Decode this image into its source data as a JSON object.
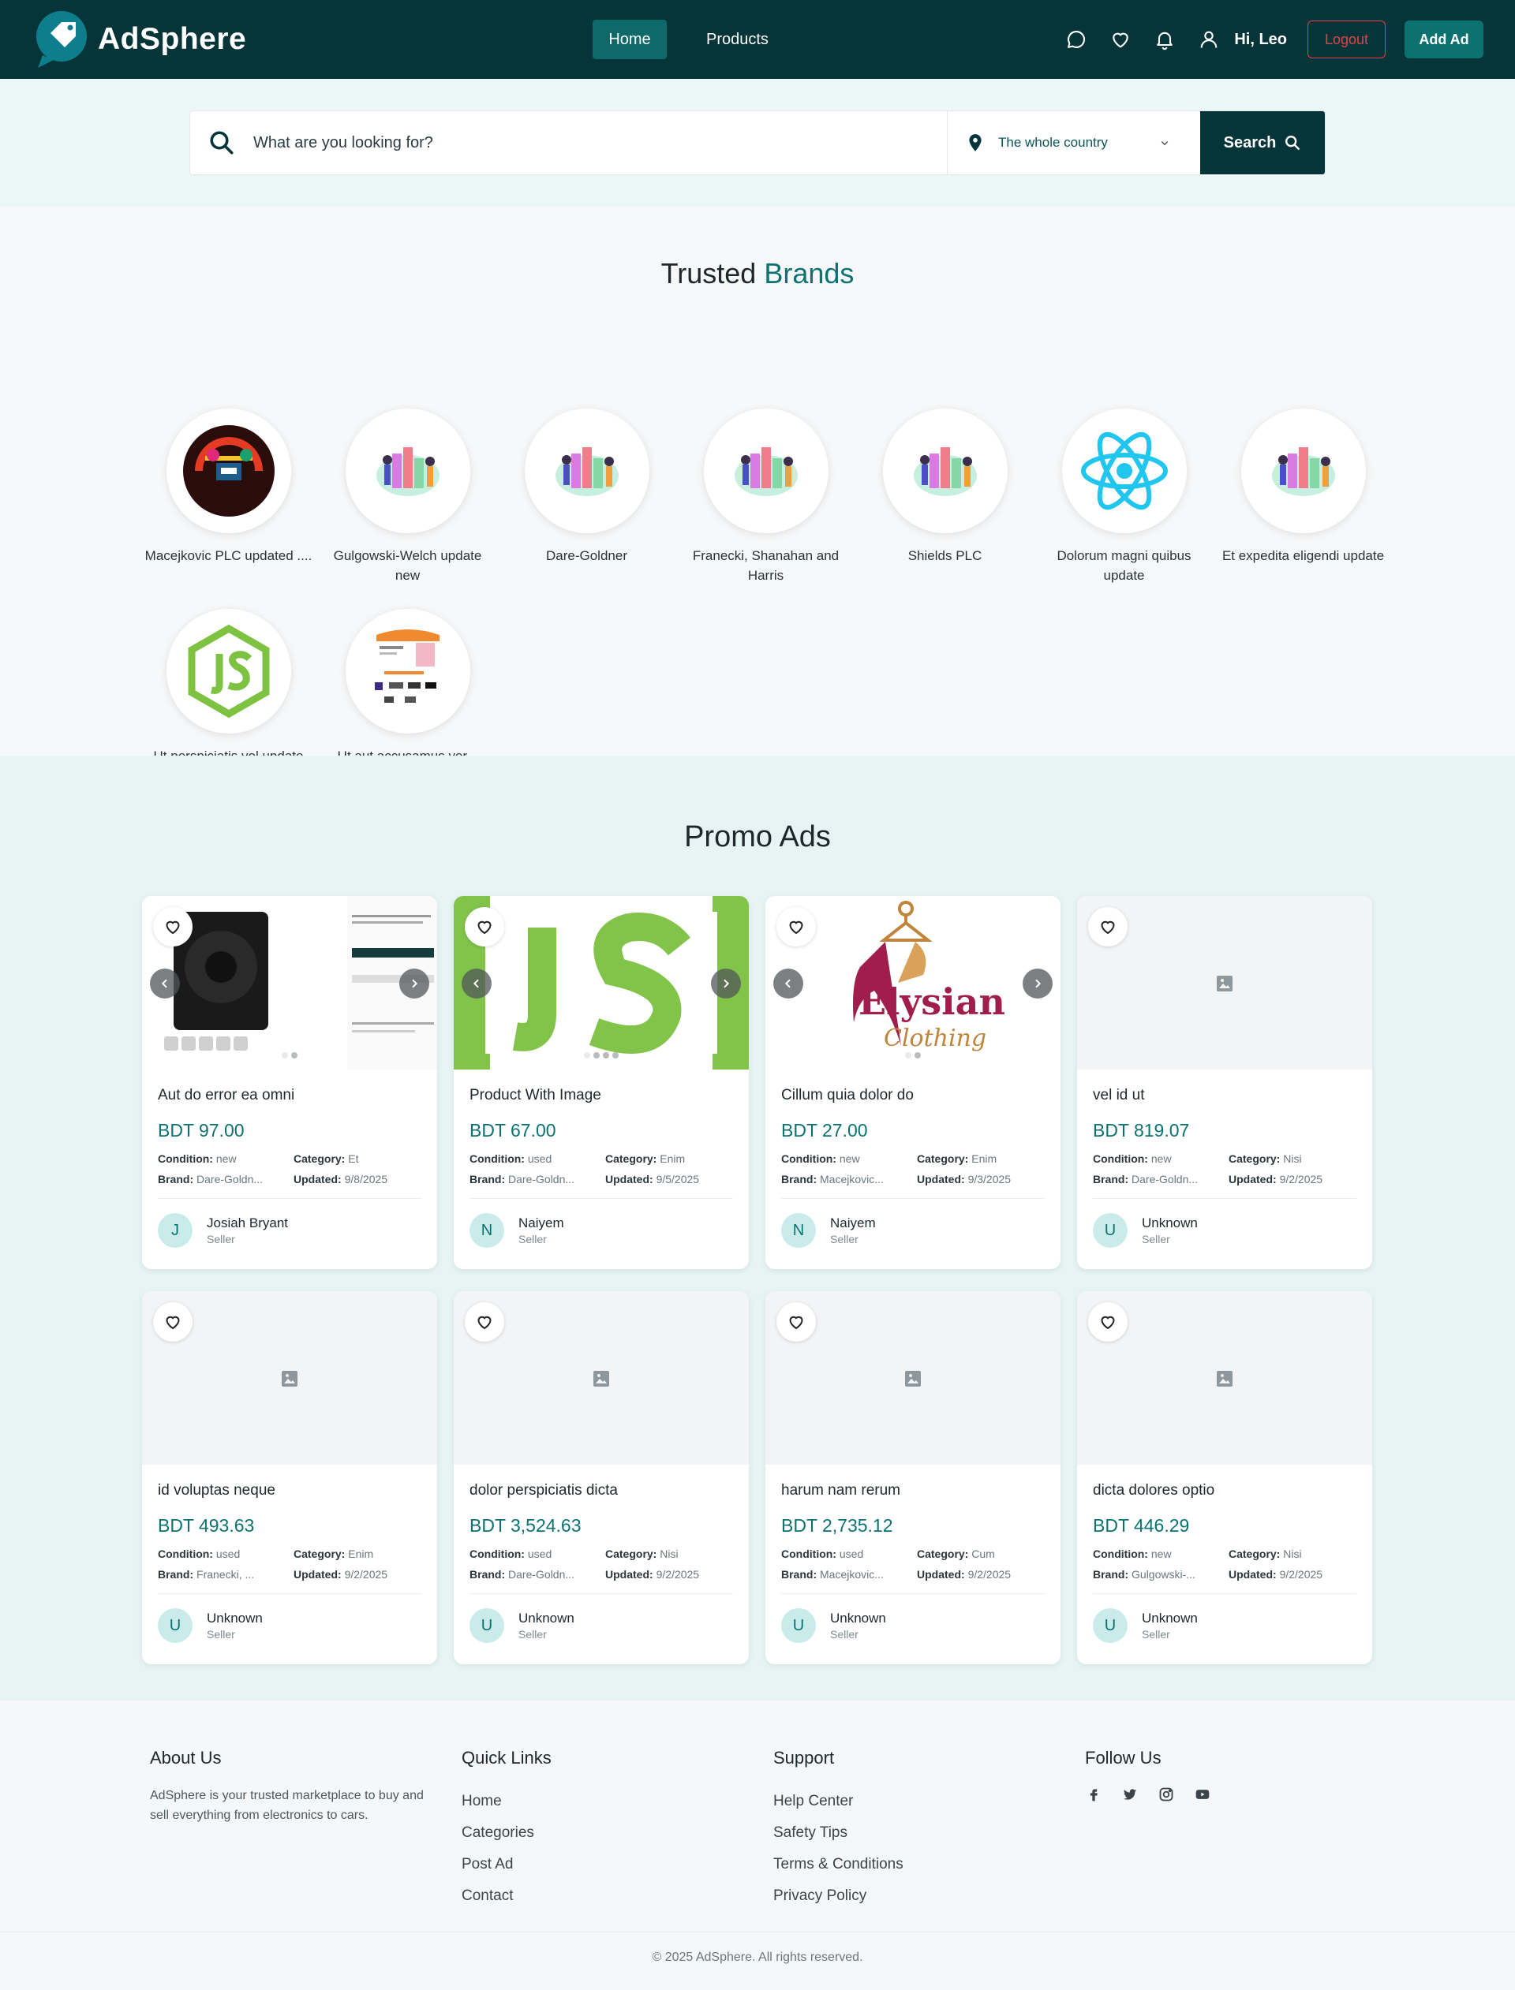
{
  "header": {
    "brand": "AdSphere",
    "nav": [
      {
        "label": "Home"
      },
      {
        "label": "Products"
      }
    ],
    "greeting": "Hi, Leo",
    "logout_label": "Logout",
    "add_ad_label": "Add Ad",
    "icons": [
      "chat-icon",
      "heart-icon",
      "bell-icon",
      "user-icon"
    ]
  },
  "search": {
    "placeholder": "What are you looking for?",
    "location": "The whole country",
    "button_label": "Search"
  },
  "brands": {
    "title_plain": "Trusted",
    "title_highlight": "Brands",
    "items": [
      {
        "name": "Macejkovic PLC updated ...."
      },
      {
        "name": "Gulgowski-Welch update new"
      },
      {
        "name": "Dare-Goldner"
      },
      {
        "name": "Franecki, Shanahan and Harris"
      },
      {
        "name": "Shields PLC"
      },
      {
        "name": "Dolorum magni quibus update"
      },
      {
        "name": "Et expedita eligendi update"
      },
      {
        "name": "Ut perspiciatis vol update"
      },
      {
        "name": "Ut aut accusamus ver... update"
      }
    ]
  },
  "promo": {
    "title": "Promo Ads",
    "labels": {
      "condition": "Condition:",
      "category": "Category:",
      "brand": "Brand:",
      "updated": "Updated:",
      "seller_role": "Seller"
    },
    "cards": [
      {
        "title": "Aut do error ea omni",
        "price": "BDT 97.00",
        "condition": "new",
        "category": "Et",
        "brand": "Dare-Goldn...",
        "updated": "9/8/2025",
        "seller": "Josiah Bryant",
        "initial": "J"
      },
      {
        "title": "Product With Image",
        "price": "BDT 67.00",
        "condition": "used",
        "category": "Enim",
        "brand": "Dare-Goldn...",
        "updated": "9/5/2025",
        "seller": "Naiyem",
        "initial": "N"
      },
      {
        "title": "Cillum quia dolor do",
        "price": "BDT 27.00",
        "condition": "new",
        "category": "Enim",
        "brand": "Macejkovic...",
        "updated": "9/3/2025",
        "seller": "Naiyem",
        "initial": "N"
      },
      {
        "title": "vel id ut",
        "price": "BDT 819.07",
        "condition": "new",
        "category": "Nisi",
        "brand": "Dare-Goldn...",
        "updated": "9/2/2025",
        "seller": "Unknown",
        "initial": "U"
      },
      {
        "title": "id voluptas neque",
        "price": "BDT 493.63",
        "condition": "used",
        "category": "Enim",
        "brand": "Franecki, ...",
        "updated": "9/2/2025",
        "seller": "Unknown",
        "initial": "U"
      },
      {
        "title": "dolor perspiciatis dicta",
        "price": "BDT 3,524.63",
        "condition": "used",
        "category": "Nisi",
        "brand": "Dare-Goldn...",
        "updated": "9/2/2025",
        "seller": "Unknown",
        "initial": "U"
      },
      {
        "title": "harum nam rerum",
        "price": "BDT 2,735.12",
        "condition": "used",
        "category": "Cum",
        "brand": "Macejkovic...",
        "updated": "9/2/2025",
        "seller": "Unknown",
        "initial": "U"
      },
      {
        "title": "dicta dolores optio",
        "price": "BDT 446.29",
        "condition": "new",
        "category": "Nisi",
        "brand": "Gulgowski-...",
        "updated": "9/2/2025",
        "seller": "Unknown",
        "initial": "U"
      }
    ]
  },
  "footer": {
    "about_title": "About Us",
    "about_text": "AdSphere is your trusted marketplace to buy and sell everything from electronics to cars.",
    "quick_title": "Quick Links",
    "quick_links": [
      "Home",
      "Categories",
      "Post Ad",
      "Contact"
    ],
    "support_title": "Support",
    "support_links": [
      "Help Center",
      "Safety Tips",
      "Terms & Conditions",
      "Privacy Policy"
    ],
    "follow_title": "Follow Us",
    "socials": [
      "facebook-icon",
      "twitter-icon",
      "instagram-icon",
      "youtube-icon"
    ],
    "copyright": "© 2025 AdSphere. All rights reserved."
  },
  "colors": {
    "primary_dark": "#053538",
    "accent": "#0c7270",
    "danger": "#e0434b",
    "promo_bg": "#e6f5f4"
  }
}
